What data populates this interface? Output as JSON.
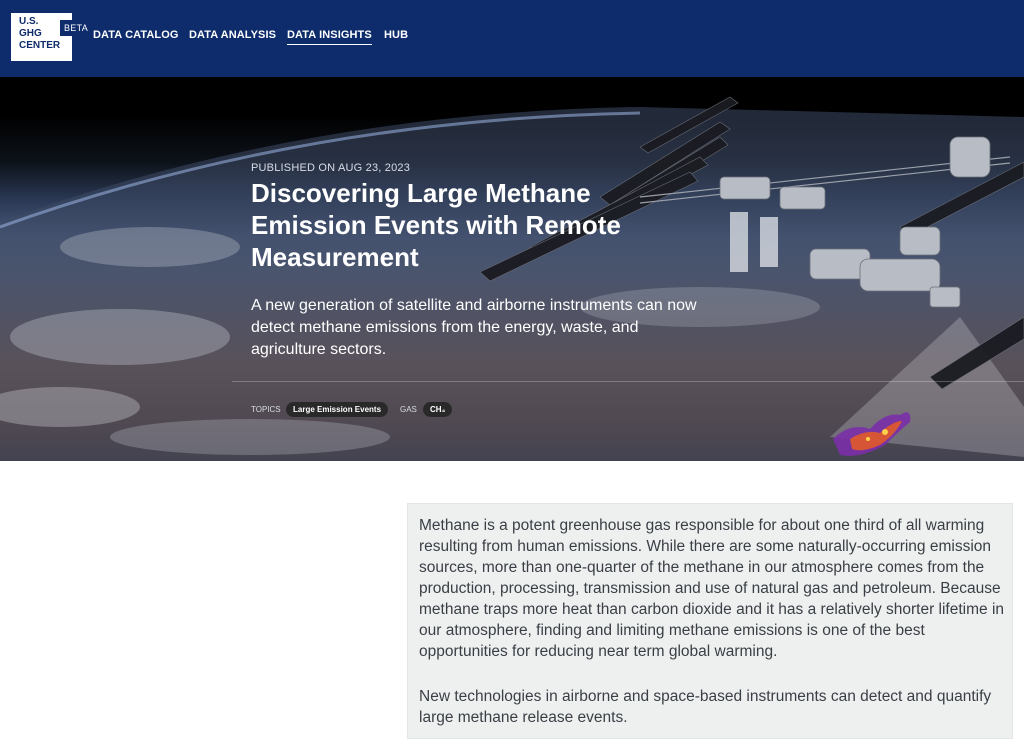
{
  "header": {
    "logo_lines": [
      "U.S.",
      "GHG",
      "CENTER"
    ],
    "beta_label": "BETA",
    "nav": [
      {
        "label": "DATA CATALOG"
      },
      {
        "label": "DATA ANALYSIS"
      },
      {
        "label": "DATA INSIGHTS",
        "active": true
      },
      {
        "label": "HUB"
      }
    ],
    "background_color": "#0e2c6b"
  },
  "hero": {
    "published": "PUBLISHED ON AUG 23, 2023",
    "title": "Discovering Large Methane Emission Events with Remote Measurement",
    "subtitle": "A new generation of satellite and airborne instruments can now detect methane emissions from the energy, waste, and agriculture sectors.",
    "topics_label": "TOPICS",
    "topic": "Large Emission Events",
    "gas_label": "GAS",
    "gas": "CH₄"
  },
  "intro": {
    "paragraph_1": "Methane is a potent greenhouse gas responsible for about one third of all warming resulting from human emissions. While there are some naturally-occurring emission sources, more than one-quarter of the methane in our atmosphere comes from the production, processing, transmission and use of natural gas and petroleum. Because methane traps more heat than carbon dioxide and it has a relatively shorter lifetime in our atmosphere, finding and limiting methane emissions is one of the best opportunities for reducing near term global warming.",
    "paragraph_2": "New technologies in airborne and space-based instruments can detect and quantify large methane release events."
  }
}
